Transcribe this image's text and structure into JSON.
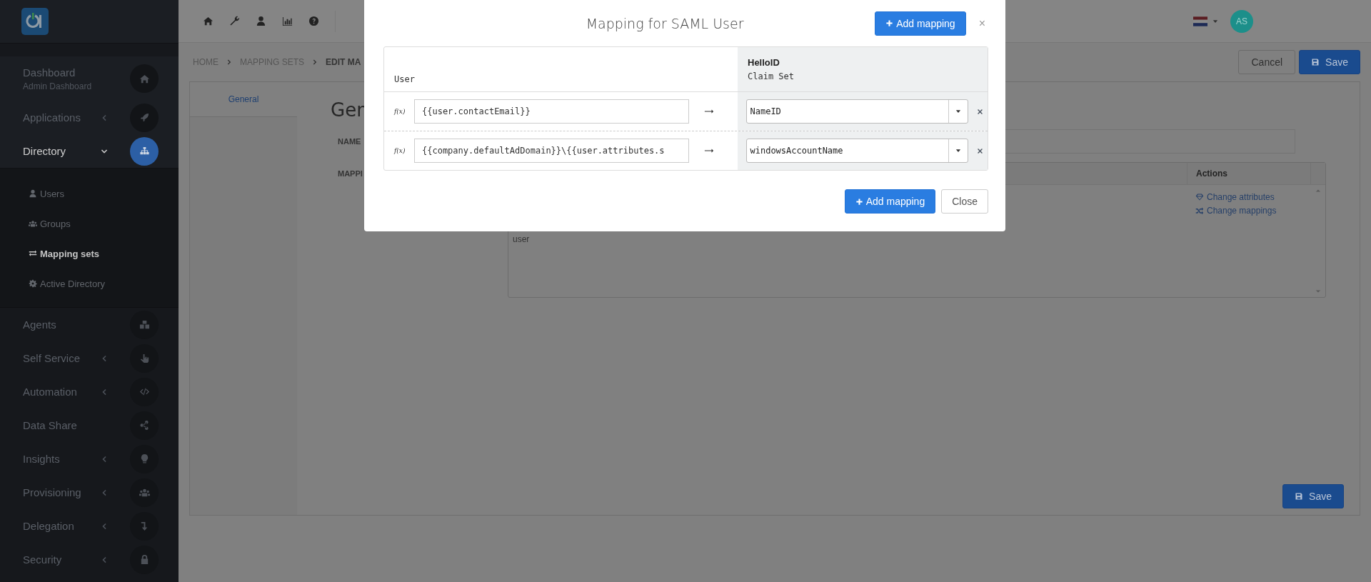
{
  "sidebar": {
    "items": [
      {
        "label": "Dashboard",
        "sublabel": "Admin Dashboard",
        "expandable": false,
        "selected": false
      },
      {
        "label": "Applications",
        "expandable": true,
        "expanded": false,
        "selected": false
      },
      {
        "label": "Directory",
        "expandable": true,
        "expanded": true,
        "selected": true,
        "children": [
          {
            "label": "Users",
            "selected": false
          },
          {
            "label": "Groups",
            "selected": false
          },
          {
            "label": "Mapping sets",
            "selected": true
          },
          {
            "label": "Active Directory",
            "selected": false
          }
        ]
      },
      {
        "label": "Agents",
        "expandable": false,
        "selected": false
      },
      {
        "label": "Self Service",
        "expandable": true,
        "expanded": false,
        "selected": false
      },
      {
        "label": "Automation",
        "expandable": true,
        "expanded": false,
        "selected": false
      },
      {
        "label": "Data Share",
        "expandable": false,
        "selected": false
      },
      {
        "label": "Insights",
        "expandable": true,
        "expanded": false,
        "selected": false
      },
      {
        "label": "Provisioning",
        "expandable": true,
        "expanded": false,
        "selected": false
      },
      {
        "label": "Delegation",
        "expandable": true,
        "expanded": false,
        "selected": false
      },
      {
        "label": "Security",
        "expandable": true,
        "expanded": false,
        "selected": false
      }
    ]
  },
  "topbar": {
    "avatar_initials": "AS"
  },
  "breadcrumb": [
    "HOME",
    "MAPPING SETS",
    "EDIT MA"
  ],
  "page_actions": {
    "cancel": "Cancel",
    "save": "Save"
  },
  "tabs": [
    {
      "label": "General",
      "selected": true
    }
  ],
  "section_title": "Gen",
  "form_labels": [
    "NAME",
    "MAPPI"
  ],
  "mapping_table": {
    "actions_header": "Actions",
    "cell": "user",
    "actions": [
      "Change attributes",
      "Change mappings"
    ]
  },
  "bottom_save": "Save",
  "modal": {
    "title": "Mapping for SAML User",
    "add_button": "Add mapping",
    "close_glyph": "×",
    "left_header": "User",
    "right_header_title": "HelloID",
    "right_header_subtitle": "Claim Set",
    "rows": [
      {
        "fx": "f(x)",
        "expression": "{{user.contactEmail}}",
        "claim": "NameID"
      },
      {
        "fx": "f(x)",
        "expression": "{{company.defaultAdDomain}}\\{{user.attributes.s",
        "claim": "windowsAccountName"
      }
    ],
    "footer_add": "Add mapping",
    "footer_close": "Close"
  }
}
